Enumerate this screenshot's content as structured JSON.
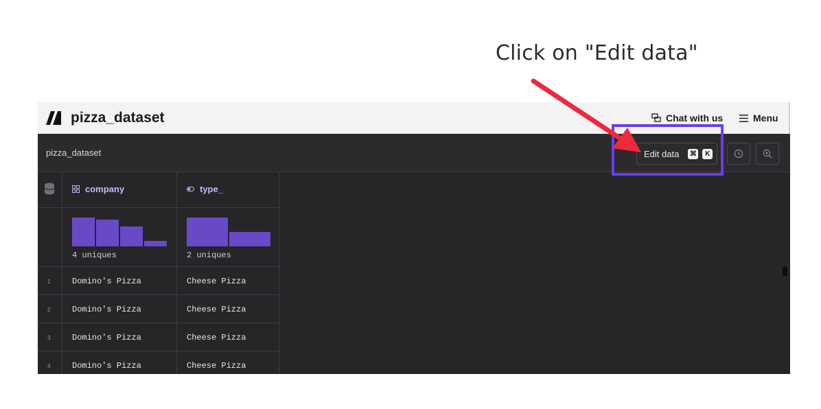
{
  "annotation": {
    "caption": "Click on \"Edit data\"",
    "highlight_color": "#6a3cf0",
    "arrow_color": "#ee2a3c"
  },
  "app": {
    "title": "pizza_dataset",
    "logo_icon": "ai-logo-icon",
    "chat_label": "Chat with us",
    "chat_icon": "chat-bubbles-icon",
    "menu_label": "Menu",
    "menu_icon": "hamburger-icon"
  },
  "toolbar": {
    "breadcrumb": "pizza_dataset",
    "edit_label": "Edit data",
    "shortcut_keys": [
      "⌘",
      "K"
    ],
    "history_icon": "clock-icon",
    "zoom_icon": "zoom-search-icon"
  },
  "table": {
    "db_icon": "database-icon",
    "columns": [
      {
        "name": "company",
        "icon": "categorical-icon",
        "summary": "4 uniques",
        "histogram": [
          1.0,
          0.92,
          0.68,
          0.18
        ]
      },
      {
        "name": "type_",
        "icon": "toggle-icon",
        "summary": "2 uniques",
        "histogram": [
          1.0,
          0.5
        ]
      }
    ],
    "rows": [
      {
        "index": "1",
        "company": "Domino's Pizza",
        "type_": "Cheese Pizza"
      },
      {
        "index": "2",
        "company": "Domino's Pizza",
        "type_": "Cheese Pizza"
      },
      {
        "index": "3",
        "company": "Domino's Pizza",
        "type_": "Cheese Pizza"
      },
      {
        "index": "4",
        "company": "Domino's Pizza",
        "type_": "Cheese Pizza"
      }
    ],
    "accent_color": "#6a49c9"
  }
}
